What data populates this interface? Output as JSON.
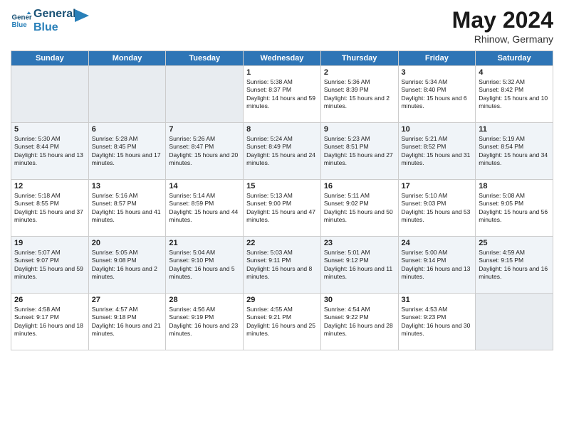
{
  "header": {
    "logo_line1": "General",
    "logo_line2": "Blue",
    "month_year": "May 2024",
    "location": "Rhinow, Germany"
  },
  "days_of_week": [
    "Sunday",
    "Monday",
    "Tuesday",
    "Wednesday",
    "Thursday",
    "Friday",
    "Saturday"
  ],
  "weeks": [
    [
      {
        "day": "",
        "text": ""
      },
      {
        "day": "",
        "text": ""
      },
      {
        "day": "",
        "text": ""
      },
      {
        "day": "1",
        "text": "Sunrise: 5:38 AM\nSunset: 8:37 PM\nDaylight: 14 hours and 59 minutes."
      },
      {
        "day": "2",
        "text": "Sunrise: 5:36 AM\nSunset: 8:39 PM\nDaylight: 15 hours and 2 minutes."
      },
      {
        "day": "3",
        "text": "Sunrise: 5:34 AM\nSunset: 8:40 PM\nDaylight: 15 hours and 6 minutes."
      },
      {
        "day": "4",
        "text": "Sunrise: 5:32 AM\nSunset: 8:42 PM\nDaylight: 15 hours and 10 minutes."
      }
    ],
    [
      {
        "day": "5",
        "text": "Sunrise: 5:30 AM\nSunset: 8:44 PM\nDaylight: 15 hours and 13 minutes."
      },
      {
        "day": "6",
        "text": "Sunrise: 5:28 AM\nSunset: 8:45 PM\nDaylight: 15 hours and 17 minutes."
      },
      {
        "day": "7",
        "text": "Sunrise: 5:26 AM\nSunset: 8:47 PM\nDaylight: 15 hours and 20 minutes."
      },
      {
        "day": "8",
        "text": "Sunrise: 5:24 AM\nSunset: 8:49 PM\nDaylight: 15 hours and 24 minutes."
      },
      {
        "day": "9",
        "text": "Sunrise: 5:23 AM\nSunset: 8:51 PM\nDaylight: 15 hours and 27 minutes."
      },
      {
        "day": "10",
        "text": "Sunrise: 5:21 AM\nSunset: 8:52 PM\nDaylight: 15 hours and 31 minutes."
      },
      {
        "day": "11",
        "text": "Sunrise: 5:19 AM\nSunset: 8:54 PM\nDaylight: 15 hours and 34 minutes."
      }
    ],
    [
      {
        "day": "12",
        "text": "Sunrise: 5:18 AM\nSunset: 8:55 PM\nDaylight: 15 hours and 37 minutes."
      },
      {
        "day": "13",
        "text": "Sunrise: 5:16 AM\nSunset: 8:57 PM\nDaylight: 15 hours and 41 minutes."
      },
      {
        "day": "14",
        "text": "Sunrise: 5:14 AM\nSunset: 8:59 PM\nDaylight: 15 hours and 44 minutes."
      },
      {
        "day": "15",
        "text": "Sunrise: 5:13 AM\nSunset: 9:00 PM\nDaylight: 15 hours and 47 minutes."
      },
      {
        "day": "16",
        "text": "Sunrise: 5:11 AM\nSunset: 9:02 PM\nDaylight: 15 hours and 50 minutes."
      },
      {
        "day": "17",
        "text": "Sunrise: 5:10 AM\nSunset: 9:03 PM\nDaylight: 15 hours and 53 minutes."
      },
      {
        "day": "18",
        "text": "Sunrise: 5:08 AM\nSunset: 9:05 PM\nDaylight: 15 hours and 56 minutes."
      }
    ],
    [
      {
        "day": "19",
        "text": "Sunrise: 5:07 AM\nSunset: 9:07 PM\nDaylight: 15 hours and 59 minutes."
      },
      {
        "day": "20",
        "text": "Sunrise: 5:05 AM\nSunset: 9:08 PM\nDaylight: 16 hours and 2 minutes."
      },
      {
        "day": "21",
        "text": "Sunrise: 5:04 AM\nSunset: 9:10 PM\nDaylight: 16 hours and 5 minutes."
      },
      {
        "day": "22",
        "text": "Sunrise: 5:03 AM\nSunset: 9:11 PM\nDaylight: 16 hours and 8 minutes."
      },
      {
        "day": "23",
        "text": "Sunrise: 5:01 AM\nSunset: 9:12 PM\nDaylight: 16 hours and 11 minutes."
      },
      {
        "day": "24",
        "text": "Sunrise: 5:00 AM\nSunset: 9:14 PM\nDaylight: 16 hours and 13 minutes."
      },
      {
        "day": "25",
        "text": "Sunrise: 4:59 AM\nSunset: 9:15 PM\nDaylight: 16 hours and 16 minutes."
      }
    ],
    [
      {
        "day": "26",
        "text": "Sunrise: 4:58 AM\nSunset: 9:17 PM\nDaylight: 16 hours and 18 minutes."
      },
      {
        "day": "27",
        "text": "Sunrise: 4:57 AM\nSunset: 9:18 PM\nDaylight: 16 hours and 21 minutes."
      },
      {
        "day": "28",
        "text": "Sunrise: 4:56 AM\nSunset: 9:19 PM\nDaylight: 16 hours and 23 minutes."
      },
      {
        "day": "29",
        "text": "Sunrise: 4:55 AM\nSunset: 9:21 PM\nDaylight: 16 hours and 25 minutes."
      },
      {
        "day": "30",
        "text": "Sunrise: 4:54 AM\nSunset: 9:22 PM\nDaylight: 16 hours and 28 minutes."
      },
      {
        "day": "31",
        "text": "Sunrise: 4:53 AM\nSunset: 9:23 PM\nDaylight: 16 hours and 30 minutes."
      },
      {
        "day": "",
        "text": ""
      }
    ]
  ]
}
